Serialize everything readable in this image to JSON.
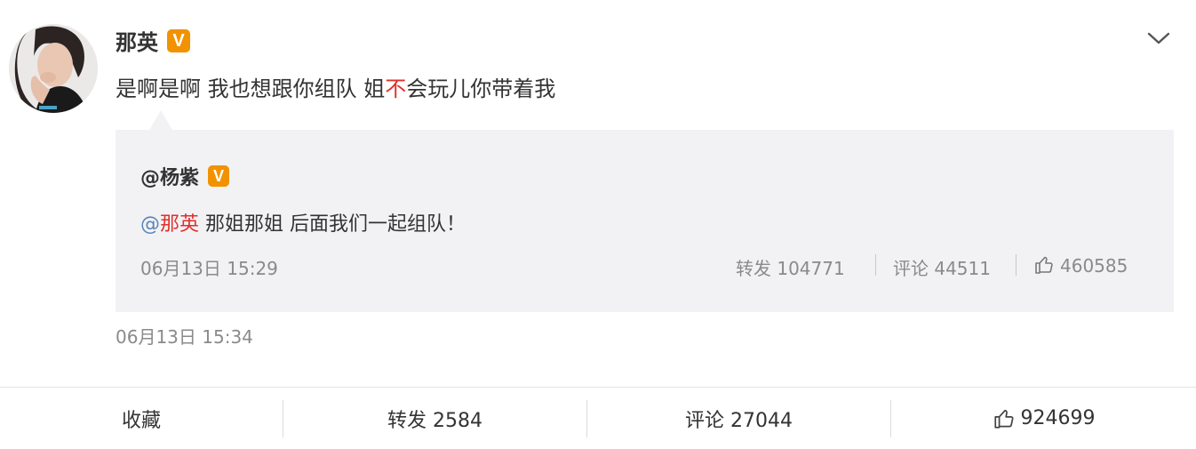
{
  "post": {
    "author": "那英",
    "verified_badge": "V",
    "text_before": "是啊是啊 我也想跟你组队 姐",
    "text_highlight": "不",
    "text_after": "会玩儿你带着我",
    "time": "06月13日 15:34",
    "menu_icon": "chevron-down-icon"
  },
  "quoted": {
    "author": "@杨紫",
    "verified_badge": "V",
    "at_symbol": "@",
    "mention": "那英",
    "text": " 那姐那姐 后面我们一起组队！",
    "time": "06月13日 15:29",
    "repost": "转发 104771",
    "comment": "评论 44511",
    "likes": "460585"
  },
  "actions": {
    "favorite": "收藏",
    "repost": "转发 2584",
    "comment": "评论 27044",
    "likes": "924699"
  },
  "colors": {
    "highlight": "#e0302b",
    "badge": "#f29200",
    "quote_bg": "#f2f2f5",
    "muted": "#8a8a8a"
  }
}
